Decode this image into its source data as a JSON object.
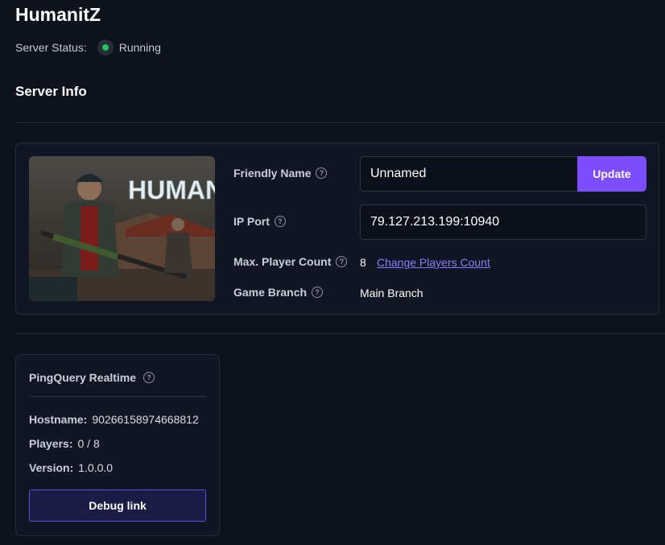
{
  "page": {
    "title": "HumanitZ"
  },
  "status": {
    "label": "Server Status:",
    "value": "Running",
    "color": "#22c55e"
  },
  "section": {
    "title": "Server Info"
  },
  "cover": {
    "logo_text": "HUMANITZ"
  },
  "fields": {
    "friendly_name": {
      "label": "Friendly Name",
      "value": "Unnamed",
      "button": "Update"
    },
    "ip_port": {
      "label": "IP Port",
      "value": "79.127.213.199:10940"
    },
    "max_players": {
      "label": "Max. Player Count",
      "value": "8",
      "link": "Change Players Count"
    },
    "game_branch": {
      "label": "Game Branch",
      "value": "Main Branch"
    }
  },
  "pingquery": {
    "title": "PingQuery Realtime",
    "hostname_label": "Hostname:",
    "hostname_value": "90266158974668812",
    "players_label": "Players:",
    "players_value": "0 / 8",
    "version_label": "Version:",
    "version_value": "1.0.0.0",
    "debug_button": "Debug link"
  },
  "colors": {
    "accent": "#7c4dff",
    "link": "#8b7cff",
    "background": "#0d121c"
  }
}
